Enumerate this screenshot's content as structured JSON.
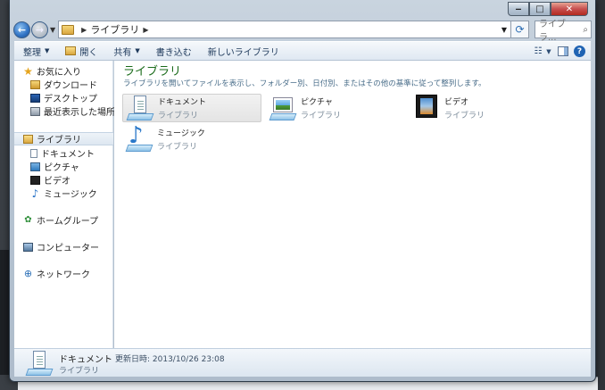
{
  "window": {
    "title_buttons": {
      "minimize": "‒",
      "maximize": "□",
      "close": "✕"
    }
  },
  "navbar": {
    "back_icon": "←",
    "forward_icon": "→",
    "address_path": "ライブラリ",
    "search_placeholder": "ライブラ..."
  },
  "toolbar": {
    "organize": "整理",
    "open": "開く",
    "share": "共有",
    "burn": "書き込む",
    "new_library": "新しいライブラリ"
  },
  "sidebar": {
    "favorites": {
      "label": "お気に入り",
      "items": [
        {
          "label": "ダウンロード"
        },
        {
          "label": "デスクトップ"
        },
        {
          "label": "最近表示した場所"
        }
      ]
    },
    "libraries": {
      "label": "ライブラリ",
      "items": [
        {
          "label": "ドキュメント"
        },
        {
          "label": "ピクチャ"
        },
        {
          "label": "ビデオ"
        },
        {
          "label": "ミュージック"
        }
      ]
    },
    "homegroup": "ホームグループ",
    "computer": "コンピューター",
    "network": "ネットワーク"
  },
  "main": {
    "title": "ライブラリ",
    "subtitle": "ライブラリを開いてファイルを表示し、フォルダー別、日付別、またはその他の基準に従って整列します。",
    "libraries": [
      {
        "name": "ドキュメント",
        "type": "ライブラリ",
        "icon": "documents-library-icon"
      },
      {
        "name": "ピクチャ",
        "type": "ライブラリ",
        "icon": "pictures-library-icon"
      },
      {
        "name": "ビデオ",
        "type": "ライブラリ",
        "icon": "videos-library-icon"
      },
      {
        "name": "ミュージック",
        "type": "ライブラリ",
        "icon": "music-library-icon"
      }
    ]
  },
  "details": {
    "name": "ドキュメント",
    "meta": "更新日時: 2013/10/26 23:08",
    "type": "ライブラリ"
  }
}
